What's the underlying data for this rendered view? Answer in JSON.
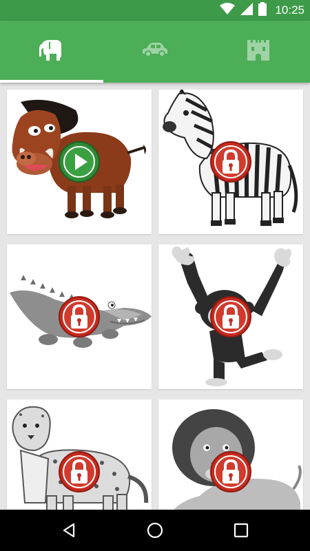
{
  "status_bar": {
    "time": "10:25",
    "icons": [
      "wifi-icon",
      "signal-icon",
      "battery-icon"
    ]
  },
  "tabs": [
    {
      "name": "tab-animals",
      "icon": "elephant-icon",
      "selected": true
    },
    {
      "name": "tab-vehicles",
      "icon": "car-icon",
      "selected": false
    },
    {
      "name": "tab-castles",
      "icon": "castle-icon",
      "selected": false
    }
  ],
  "cards": [
    {
      "animal": "warthog",
      "state": "unlocked",
      "badge_icon": "play-icon"
    },
    {
      "animal": "zebra",
      "state": "locked",
      "badge_icon": "lock-icon"
    },
    {
      "animal": "crocodile",
      "state": "locked",
      "badge_icon": "lock-icon"
    },
    {
      "animal": "monkey",
      "state": "locked",
      "badge_icon": "lock-icon"
    },
    {
      "animal": "leopard",
      "state": "locked",
      "badge_icon": "lock-icon"
    },
    {
      "animal": "lion",
      "state": "locked",
      "badge_icon": "lock-icon"
    }
  ],
  "nav_bar": {
    "icons": [
      "back-icon",
      "home-icon",
      "recents-icon"
    ]
  },
  "colors": {
    "status_bar": "#3d9a49",
    "tab_bar": "#4cae57",
    "tab_indicator": "#ffffff",
    "grid_background": "#e6e6e6",
    "play_badge": "#2e8b35",
    "lock_badge": "#c62a1e"
  }
}
